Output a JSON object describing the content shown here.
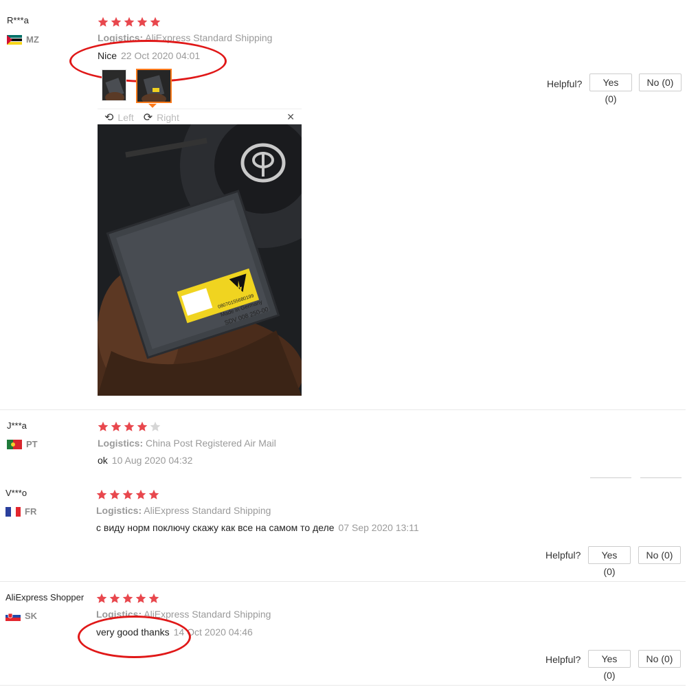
{
  "reviews": [
    {
      "name": "R***a",
      "country": "MZ",
      "stars": 5,
      "logistics_label": "Logistics:",
      "logistics": "AliExpress Standard Shipping",
      "text": "Nice",
      "date": "22 Oct 2020 04:01",
      "helpful_label": "Helpful?",
      "yes_label": "Yes (0)",
      "no_label": "No (0)",
      "viewer": {
        "left_label": "Left",
        "right_label": "Right",
        "close_label": "✕"
      }
    },
    {
      "name": "J***a",
      "country": "PT",
      "stars": 4,
      "logistics_label": "Logistics:",
      "logistics": "China Post Registered Air Mail",
      "text": "ok",
      "date": "10 Aug 2020 04:32"
    },
    {
      "name": "V***o",
      "country": "FR",
      "stars": 5,
      "logistics_label": "Logistics:",
      "logistics": "AliExpress Standard Shipping",
      "text": "с виду норм поключу скажу как все на самом то деле",
      "date": "07 Sep 2020 13:11",
      "helpful_label": "Helpful?",
      "yes_label": "Yes (0)",
      "no_label": "No (0)"
    },
    {
      "name": "AliExpress Shopper",
      "country": "SK",
      "stars": 5,
      "logistics_label": "Logistics:",
      "logistics": "AliExpress Standard Shipping",
      "text": "very good thanks",
      "date": "14 Oct 2020 04:46",
      "helpful_label": "Helpful?",
      "yes_label": "Yes (0)",
      "no_label": "No (0)"
    }
  ],
  "colors": {
    "star_filled": "#e8474d",
    "star_empty": "#d6d6d6",
    "annotation_ring": "#e01818",
    "thumb_active_border": "#ff7a1a"
  },
  "photo_label": {
    "line1": "SDV 008 250-00",
    "line2": "Made in Germany",
    "line3": "08070155680199"
  }
}
